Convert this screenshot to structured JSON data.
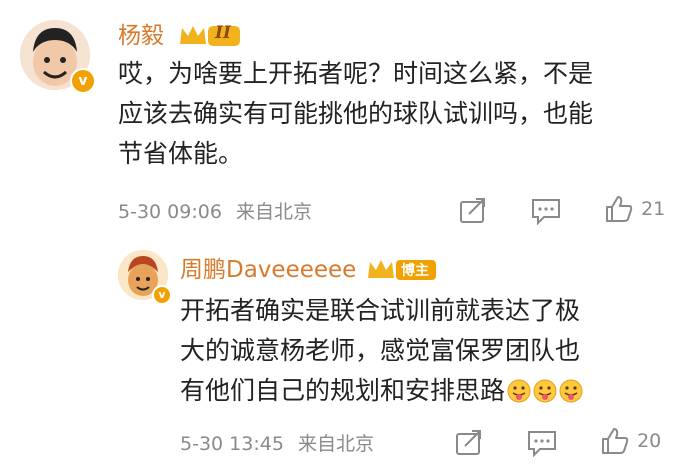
{
  "comment": {
    "author": "杨毅",
    "level_badge": "II",
    "text_lines": [
      "哎，为啥要上开拓者呢？时间这么紧，不是",
      "应该去确实有可能挑他的球队试训吗，也能",
      "节省体能。"
    ],
    "date": "5-30 09:06",
    "source": "来自北京",
    "like_count": "21"
  },
  "reply": {
    "author": "周鹏Daveeeeee",
    "role_badge": "博主",
    "text_lines": [
      "开拓者确实是联合试训前就表达了极",
      "大的诚意杨老师，感觉富保罗团队也",
      "有他们自己的规划和安排思路"
    ],
    "emoji_count_label": "😛😛😛",
    "date": "5-30 13:45",
    "source": "来自北京",
    "like_count": "20"
  },
  "colors": {
    "name": "#d87a2c",
    "meta": "#8a8a8a",
    "verified": "#f2a200"
  },
  "icons": [
    "repost-icon",
    "comment-icon",
    "like-icon",
    "verified-icon",
    "crown-badge-icon"
  ]
}
